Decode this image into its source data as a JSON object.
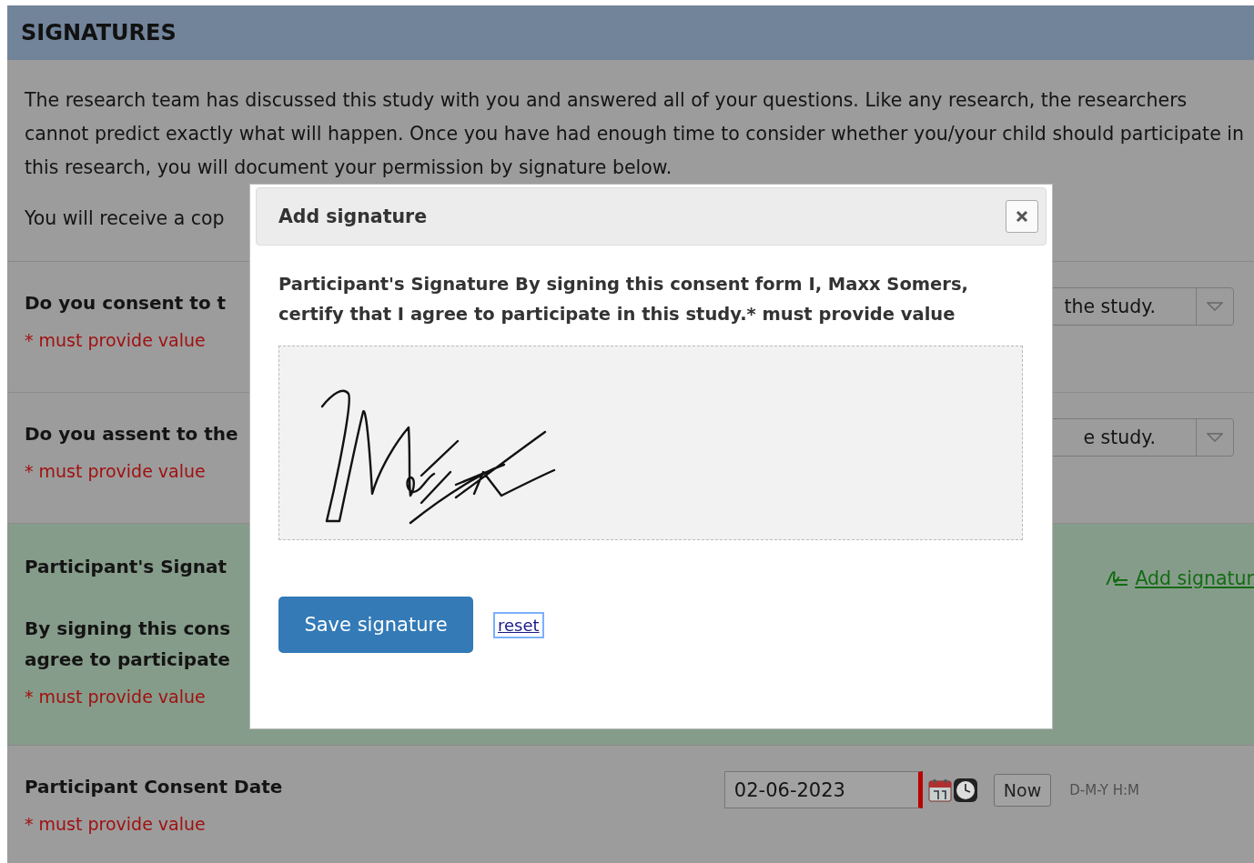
{
  "section": {
    "title": "SIGNATURES"
  },
  "intro": [
    "The research team has discussed this study with you and answered all of your questions. Like any research, the researchers cannot predict exactly what will happen. Once you have had enough time to consider whether you/your child should participate in this research, you will document your permission by signature below.",
    "You will receive a cop"
  ],
  "fields": [
    {
      "kind": "dropdown",
      "highlighted": false,
      "label": "Do you consent to t",
      "note": "* must provide value",
      "value": "the study."
    },
    {
      "kind": "dropdown",
      "highlighted": false,
      "label": "Do you assent to the",
      "note": "* must provide value",
      "value": "e study."
    },
    {
      "kind": "signature",
      "highlighted": true,
      "label": "Participant's Signat",
      "lines": [
        "By signing this cons",
        "agree to participate"
      ],
      "note": "* must provide value",
      "link": "Add signatur"
    },
    {
      "kind": "datetime",
      "highlighted": false,
      "label": "Participant Consent Date",
      "note": "* must provide value",
      "value": "02-06-2023",
      "button": "Now",
      "format": "D-M-Y H:M"
    }
  ],
  "dialog": {
    "title": "Add signature",
    "prompt": "Participant's Signature By signing this consent form I, Maxx Somers, certify that I agree to participate in this study.* must provide value",
    "save_button": "Save signature",
    "reset_link": "reset"
  }
}
